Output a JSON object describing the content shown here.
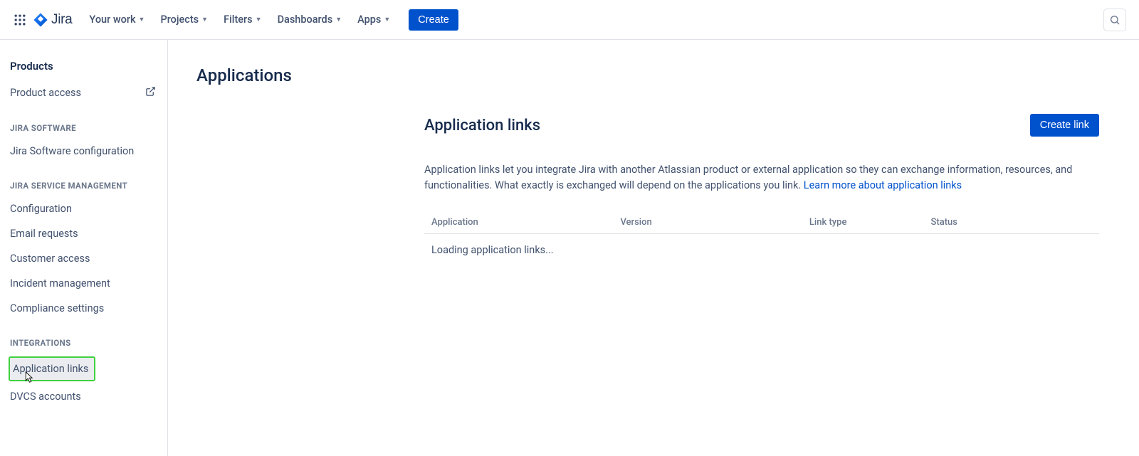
{
  "nav": {
    "logo": "Jira",
    "items": [
      "Your work",
      "Projects",
      "Filters",
      "Dashboards",
      "Apps"
    ],
    "create": "Create"
  },
  "sidebar": {
    "heading": "Products",
    "product_access": "Product access",
    "groups": [
      {
        "label": "JIRA SOFTWARE",
        "items": [
          "Jira Software configuration"
        ]
      },
      {
        "label": "JIRA SERVICE MANAGEMENT",
        "items": [
          "Configuration",
          "Email requests",
          "Customer access",
          "Incident management",
          "Compliance settings"
        ]
      },
      {
        "label": "INTEGRATIONS",
        "items": [
          "Application links",
          "DVCS accounts"
        ]
      }
    ]
  },
  "main": {
    "page_title": "Applications",
    "section_title": "Application links",
    "create_link": "Create link",
    "description": "Application links let you integrate Jira with another Atlassian product or external application so they can exchange information, resources, and functionalities. What exactly is exchanged will depend on the applications you link. ",
    "learn_more": "Learn more about application links",
    "table": {
      "headers": [
        "Application",
        "Version",
        "Link type",
        "Status"
      ],
      "loading": "Loading application links..."
    }
  }
}
